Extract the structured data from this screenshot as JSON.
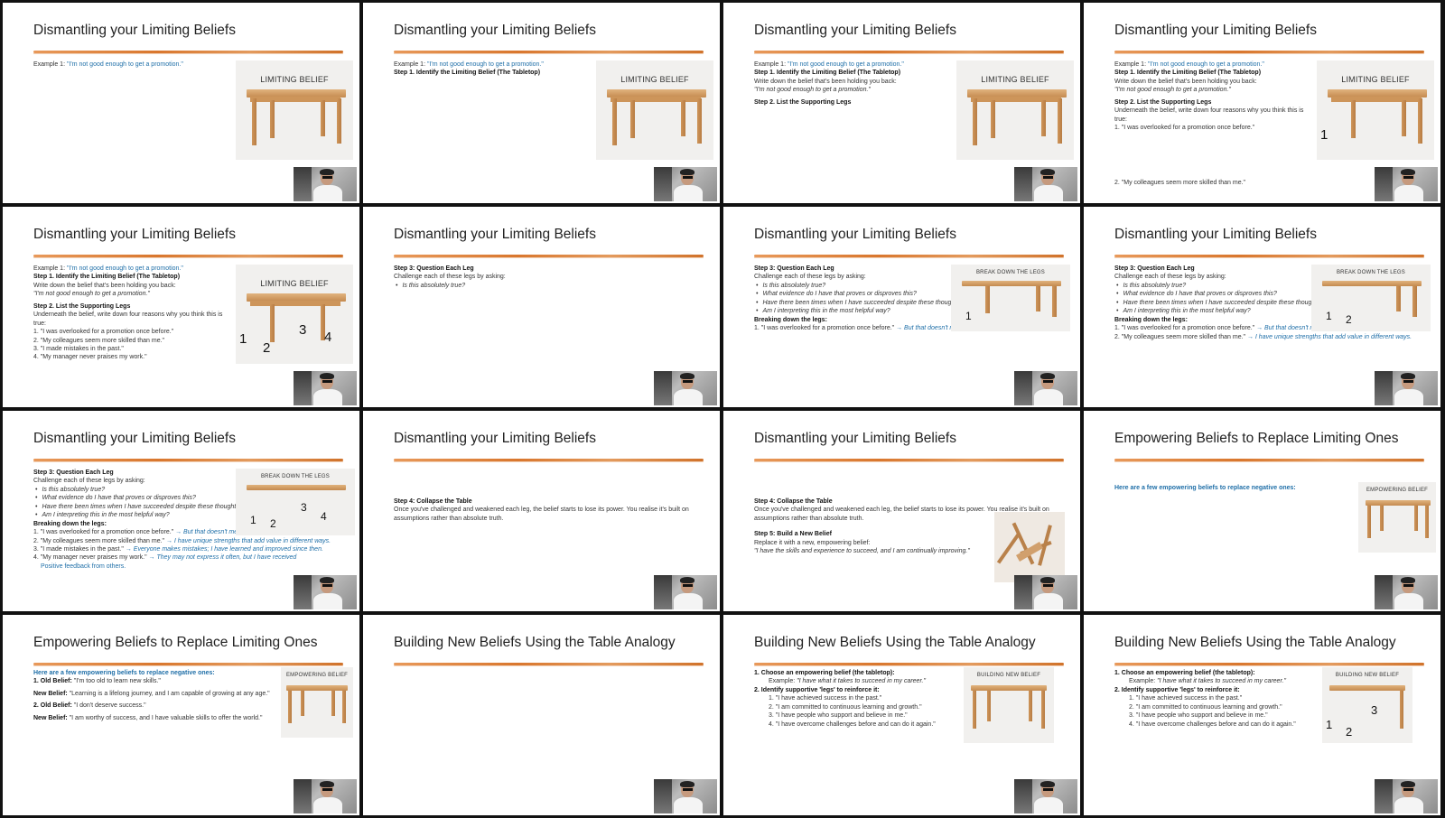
{
  "common": {
    "title_dismantle": "Dismantling your Limiting Beliefs",
    "title_empower": "Empowering Beliefs to Replace Limiting Ones",
    "title_build": "Building New Beliefs Using the Table Analogy",
    "example_prefix": "Example 1: ",
    "example_quote": "\"I'm not good enough to get a promotion.\"",
    "step1_heading": "Step 1. Identify the Limiting Belief (The Tabletop)",
    "step1_instr": "Write down the belief that's been holding you back:",
    "step1_quote": "\"I'm not good enough to get a promotion.\"",
    "step2_heading": "Step 2. List the Supporting Legs",
    "step2_instr": "Underneath the belief, write down four reasons why you think this is true:",
    "legs": [
      "1. \"I was overlooked for a promotion once before.\"",
      "2. \"My colleagues seem more skilled than me.\"",
      "3. \"I made mistakes in the past.\"",
      "4. \"My manager never praises my work.\""
    ],
    "step3_heading": "Step 3: Question Each Leg",
    "step3_instr": "Challenge each of these legs by asking:",
    "questions": [
      "Is this absolutely true?",
      "What evidence do I have that proves or disproves this?",
      "Have there been times when I have succeeded despite these thoughts?",
      "Am I interpreting this in the most helpful way?"
    ],
    "breaking_heading": "Breaking down the legs:",
    "breaks": [
      {
        "leg": "1. \"I was overlooked for a promotion once before.\"",
        "arrow": " → But that doesn't mean I won't succeed next time."
      },
      {
        "leg": "2. \"My colleagues seem more skilled than me.\"",
        "arrow": " → I have unique strengths that add value in different ways."
      },
      {
        "leg": "3. \"I made mistakes in the past.\"",
        "arrow": " → Everyone makes mistakes; I have learned and improved since then."
      },
      {
        "leg": "4. \"My manager never praises my work.\"",
        "arrow": " → They may not express it often, but I have received"
      }
    ],
    "break4_cont": "Positive feedback from others.",
    "step4_heading": "Step 4: Collapse the Table",
    "step4_text": "Once you've challenged and weakened each leg, the belief starts to lose its power. You realise it's built on assumptions rather than absolute truth.",
    "step5_heading": "Step 5: Build a New Belief",
    "step5_instr": "Replace it with a new, empowering belief:",
    "step5_quote": "\"I have the skills and experience to succeed, and I am continually improving.\"",
    "empower_intro": "Here are a few empowering beliefs to replace negative ones:",
    "old1_label": "1. Old Belief:",
    "old1_text": " \"I'm too old to learn new skills.\"",
    "new1_label": "New Belief:",
    "new1_text": " \"Learning is a lifelong journey, and I am capable of growing at any age.\"",
    "old2_label": "2. Old Belief:",
    "old2_text": " \"I don't deserve success.\"",
    "new2_label": "New Belief:",
    "new2_text": " \"I am worthy of success, and I have valuable skills to offer the world.\"",
    "build1_heading": "1. Choose an empowering belief (the tabletop):",
    "build1_example_label": "Example: ",
    "build1_example": "\"I have what it takes to succeed in my career.\"",
    "build2_heading": "2. Identify supportive 'legs' to reinforce it:",
    "build_legs": [
      "1. \"I have achieved success in the past.\"",
      "2. \"I am committed to continuous learning and growth.\"",
      "3. \"I have people who support and believe in me.\"",
      "4. \"I have overcome challenges before and can do it again.\""
    ],
    "img_limiting": "LIMITING BELIEF",
    "img_breakdown": "BREAK DOWN THE LEGS",
    "img_empowering": "EMPOWERING BELIEF",
    "img_building": "BUILDING NEW BELIEF",
    "n1": "1",
    "n2": "2",
    "n3": "3",
    "n4": "4"
  }
}
